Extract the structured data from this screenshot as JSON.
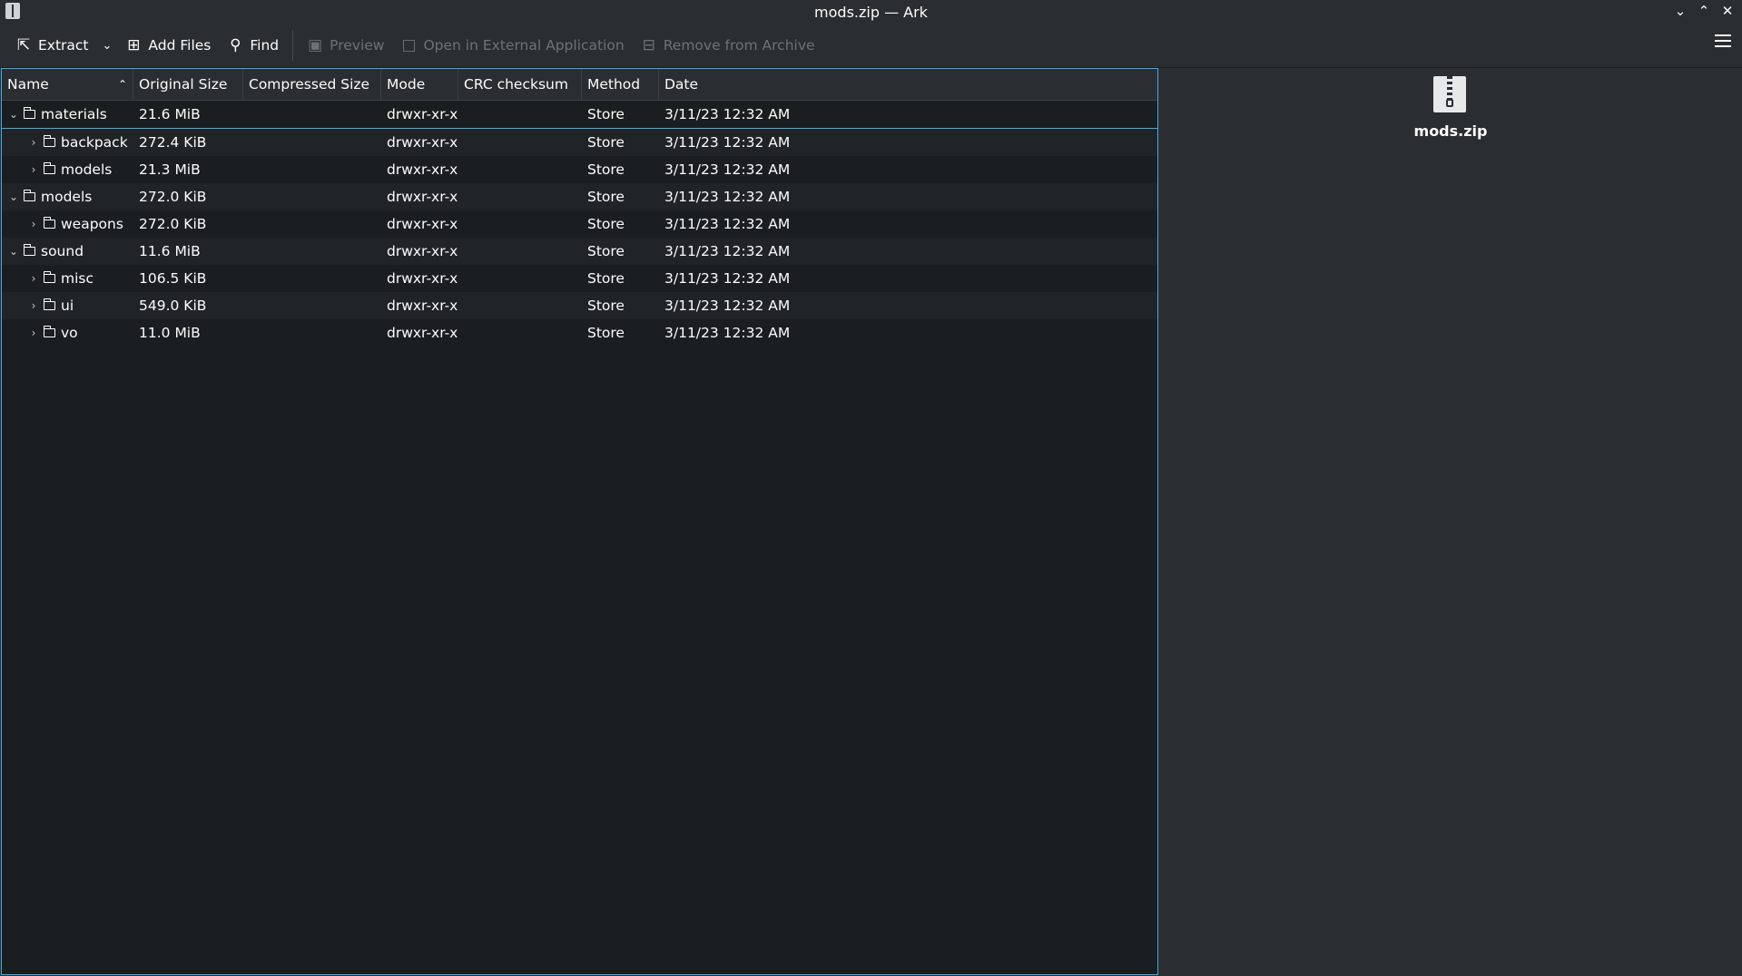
{
  "window": {
    "title": "mods.zip — Ark"
  },
  "toolbar": {
    "extract": "Extract",
    "add_files": "Add Files",
    "find": "Find",
    "preview": "Preview",
    "open_external": "Open in External Application",
    "remove": "Remove from Archive"
  },
  "columns": [
    "Name",
    "Original Size",
    "Compressed Size",
    "Mode",
    "CRC checksum",
    "Method",
    "Date"
  ],
  "rows": [
    {
      "name": "materials",
      "size": "21.6 MiB",
      "compressed": "",
      "mode": "drwxr-xr-x",
      "crc": "",
      "method": "Store",
      "date": "3/11/23 12:32 AM",
      "depth": 0,
      "expanded": true
    },
    {
      "name": "backpack",
      "size": "272.4 KiB",
      "compressed": "",
      "mode": "drwxr-xr-x",
      "crc": "",
      "method": "Store",
      "date": "3/11/23 12:32 AM",
      "depth": 1,
      "expanded": false
    },
    {
      "name": "models",
      "size": "21.3 MiB",
      "compressed": "",
      "mode": "drwxr-xr-x",
      "crc": "",
      "method": "Store",
      "date": "3/11/23 12:32 AM",
      "depth": 1,
      "expanded": false
    },
    {
      "name": "models",
      "size": "272.0 KiB",
      "compressed": "",
      "mode": "drwxr-xr-x",
      "crc": "",
      "method": "Store",
      "date": "3/11/23 12:32 AM",
      "depth": 0,
      "expanded": true
    },
    {
      "name": "weapons",
      "size": "272.0 KiB",
      "compressed": "",
      "mode": "drwxr-xr-x",
      "crc": "",
      "method": "Store",
      "date": "3/11/23 12:32 AM",
      "depth": 1,
      "expanded": false
    },
    {
      "name": "sound",
      "size": "11.6 MiB",
      "compressed": "",
      "mode": "drwxr-xr-x",
      "crc": "",
      "method": "Store",
      "date": "3/11/23 12:32 AM",
      "depth": 0,
      "expanded": true
    },
    {
      "name": "misc",
      "size": "106.5 KiB",
      "compressed": "",
      "mode": "drwxr-xr-x",
      "crc": "",
      "method": "Store",
      "date": "3/11/23 12:32 AM",
      "depth": 1,
      "expanded": false
    },
    {
      "name": "ui",
      "size": "549.0 KiB",
      "compressed": "",
      "mode": "drwxr-xr-x",
      "crc": "",
      "method": "Store",
      "date": "3/11/23 12:32 AM",
      "depth": 1,
      "expanded": false
    },
    {
      "name": "vo",
      "size": "11.0 MiB",
      "compressed": "",
      "mode": "drwxr-xr-x",
      "crc": "",
      "method": "Store",
      "date": "3/11/23 12:32 AM",
      "depth": 1,
      "expanded": false
    }
  ],
  "info_panel": {
    "filename": "mods.zip",
    "icon": "archive-zip-icon"
  },
  "colors": {
    "accent": "#3daee9",
    "window_bg": "#2a2e32",
    "view_bg": "#1b1e20",
    "text": "#fcfcfc"
  }
}
